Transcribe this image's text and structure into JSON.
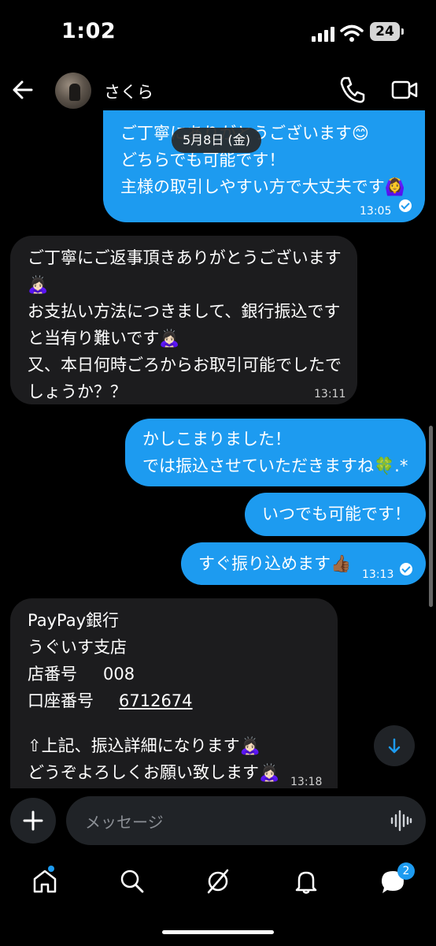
{
  "status_bar": {
    "time": "1:02",
    "battery": "24"
  },
  "header": {
    "contact_name": "さくら",
    "date_label": "5月8日 (金)"
  },
  "messages": [
    {
      "dir": "out",
      "text": "ご丁寧にありがとうございます😊\nどちらでも可能です！\n主様の取引しやすい方で大丈夫です🙆‍♀️",
      "time": "13:05"
    },
    {
      "dir": "in",
      "text": "ご丁寧にご返事頂きありがとうございます\n🙇🏻‍♀️\nお支払い方法につきまして、銀行振込です\nと当有り難いです🙇🏻‍♀️\n又、本日何時ごろからお取引可能でしたで\nしょうか？？",
      "time": "13:11"
    },
    {
      "dir": "out",
      "text": "かしこまりました！\nでは振込させていただきますね🍀.*",
      "time": ""
    },
    {
      "dir": "out",
      "text": "いつでも可能です！",
      "time": ""
    },
    {
      "dir": "out",
      "text": "すぐ振り込めます👍🏾",
      "time": "13:13"
    },
    {
      "dir": "in",
      "bank": "PayPay銀行",
      "branch": "うぐいす支店",
      "branch_no_label": "店番号",
      "branch_no": "008",
      "account_label": "口座番号",
      "account_no": "6712674",
      "line1": "⇧上記、振込詳細になります🙇🏻‍♀️",
      "line2": "どうぞよろしくお願い致します🙇🏻‍♀️",
      "time": "13:18"
    }
  ],
  "composer": {
    "placeholder": "メッセージ"
  },
  "tabbar": {
    "messages_badge": "2"
  },
  "colors": {
    "accent": "#1d9bf0",
    "incoming": "#1c1c1e",
    "background": "#000000"
  }
}
